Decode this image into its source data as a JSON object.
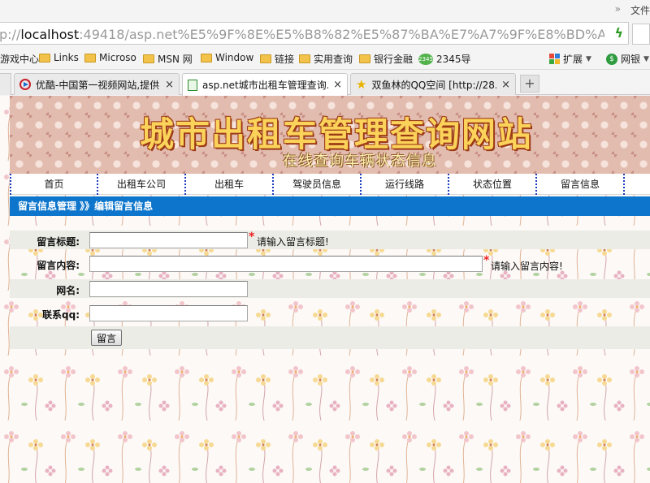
{
  "browser": {
    "menu_chevrons": "»",
    "menu_file": "文件",
    "address_scheme": "p://",
    "address_host": "localhost",
    "address_rest": ":49418/asp.net%E5%9F%8E%E5%B8%82%E5%87%BA%E7%A7%9F%E8%BD%A6%E7%AE%A1%E",
    "bookmarks": [
      "游戏中心",
      "Links",
      "Microso",
      "MSN 网",
      "Window",
      "链接",
      "实用查询",
      "银行金融",
      "2345导"
    ],
    "extend_label": "扩展",
    "bank_label": "网银",
    "tabs": [
      {
        "label": "优酷-中国第一视频网站,提供...",
        "close": "×"
      },
      {
        "label": "asp.net城市出租车管理查询...",
        "close": "×"
      },
      {
        "label": "双鱼林的QQ空间 [http://28...",
        "close": "×"
      }
    ],
    "new_tab": "+"
  },
  "site": {
    "banner_title": "城市出租车管理查询网站",
    "banner_subtitle": "在线查询车辆状态信息",
    "nav": [
      "首页",
      "出租车公司",
      "出租车",
      "驾驶员信息",
      "运行线路",
      "状态位置",
      "留言信息"
    ],
    "breadcrumb": "留言信息管理 》》编辑留言信息"
  },
  "form": {
    "title_label": "留言标题:",
    "title_value": "",
    "title_required": "*",
    "title_hint": "请输入留言标题!",
    "content_label": "留言内容:",
    "content_value": "",
    "content_required": "*",
    "content_hint": "请输入留言内容!",
    "name_label": "网名:",
    "name_value": "",
    "qq_label": "联系qq:",
    "qq_value": "",
    "submit_label": "留言"
  },
  "colors": {
    "breadcrumb_bg": "#0d76cc",
    "nav_divider": "#1a3bbf",
    "banner_title": "#fbd35a",
    "required_star": "#e22222"
  }
}
